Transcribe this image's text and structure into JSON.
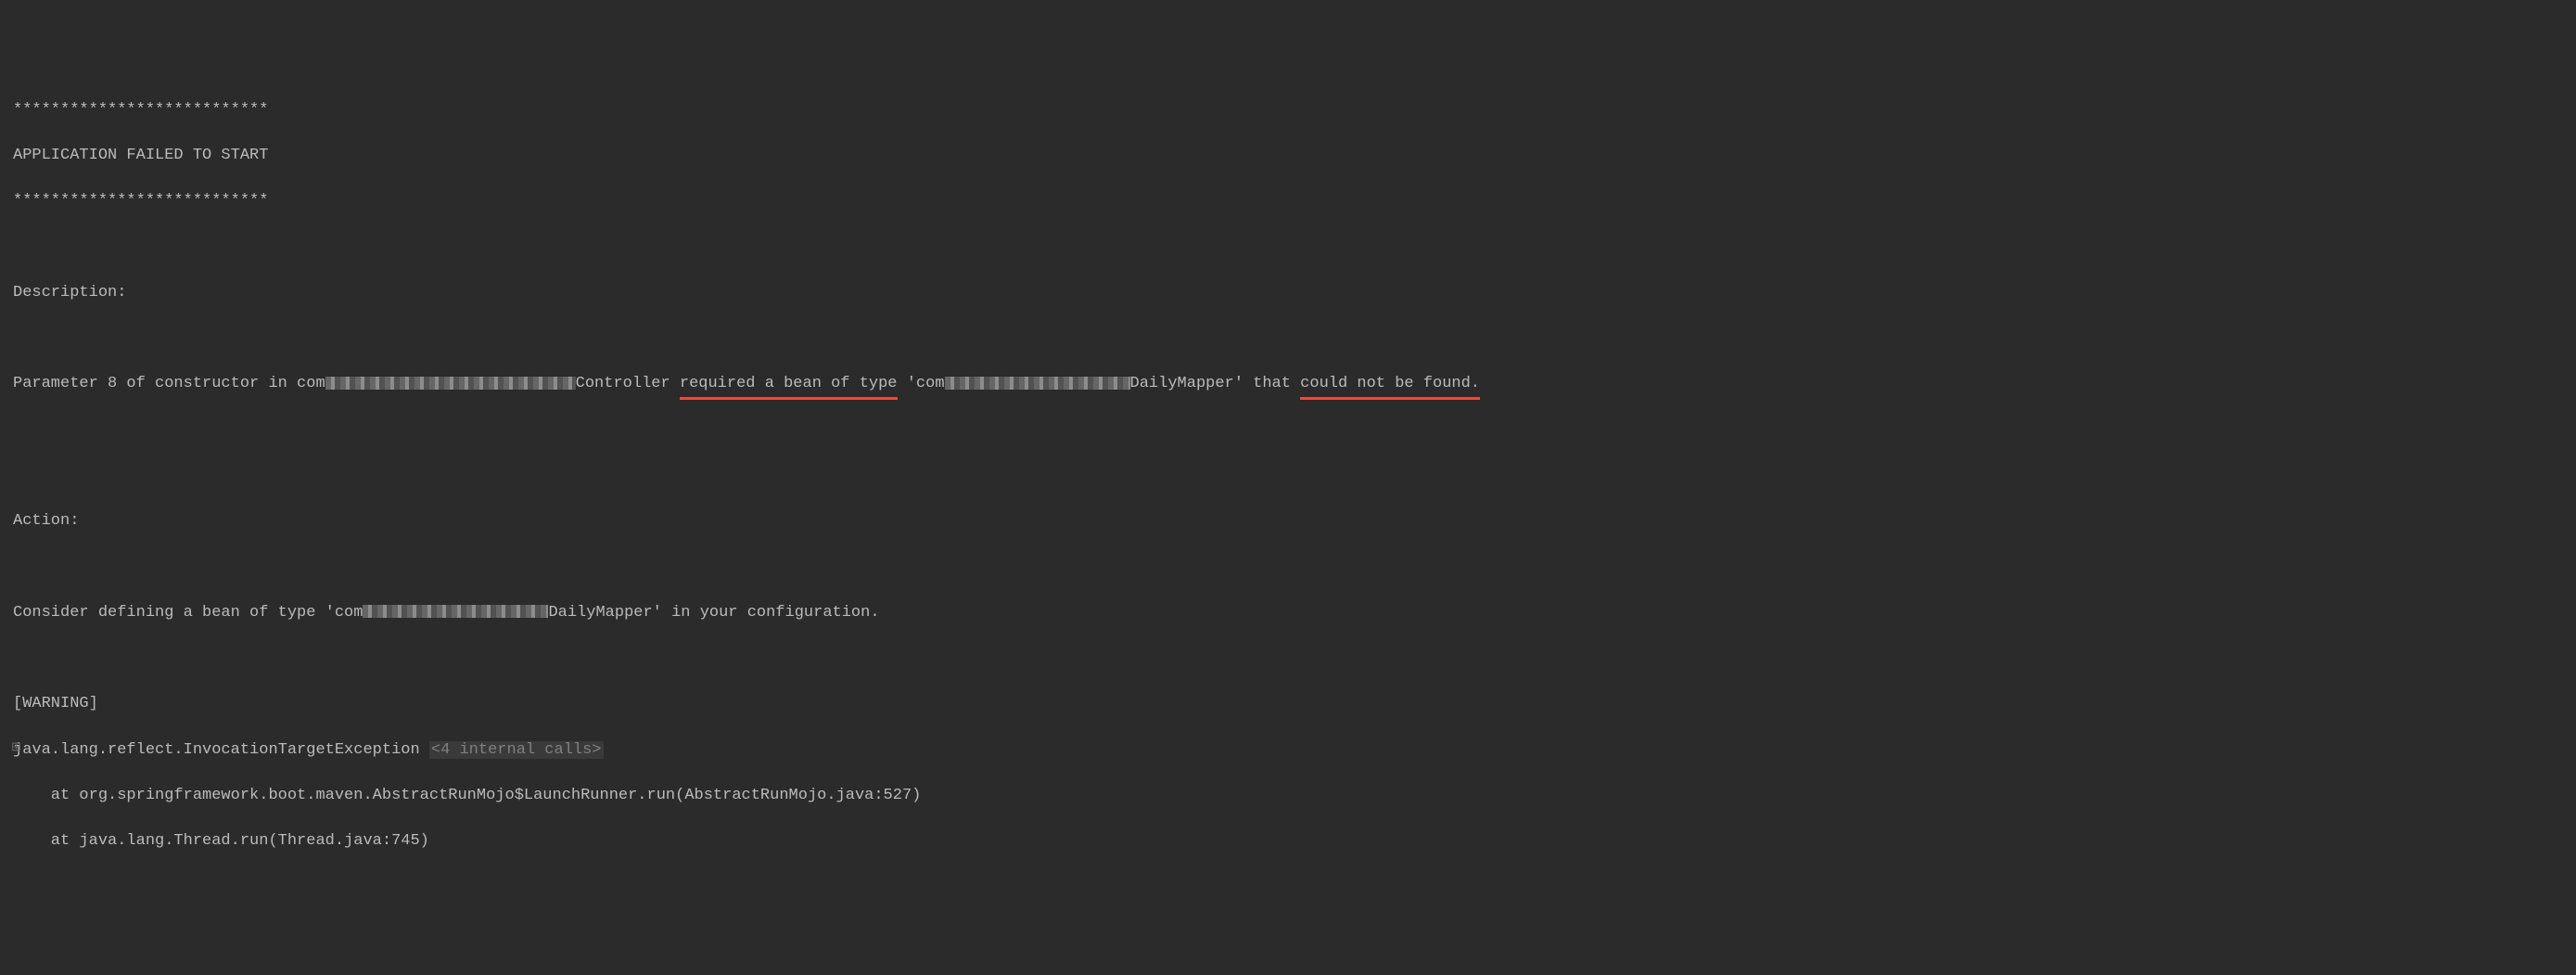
{
  "lines": {
    "divider_top": "***************************",
    "title": "APPLICATION FAILED TO START",
    "divider_bottom": "***************************",
    "description_label": "Description:",
    "param_prefix": "Parameter 8 of constructor in com",
    "controller_suffix": "Controller ",
    "required_bean": "required a bean of type",
    "com_prefix": " 'com",
    "daily_mapper": "DailyMapper' that ",
    "could_not_be_found": "could not be found.",
    "action_label": "Action:",
    "consider_prefix": "Consider defining a bean of type 'com",
    "consider_suffix": "DailyMapper' in your configuration.",
    "warning": "[WARNING]",
    "exception": "java.lang.reflect.InvocationTargetException ",
    "internal_calls": "<4 internal calls>",
    "stack1": "    at org.springframework.boot.maven.AbstractRunMojo$LaunchRunner.run(AbstractRunMojo.java:527)",
    "stack2": "    at java.lang.Thread.run(Thread.java:745)"
  }
}
